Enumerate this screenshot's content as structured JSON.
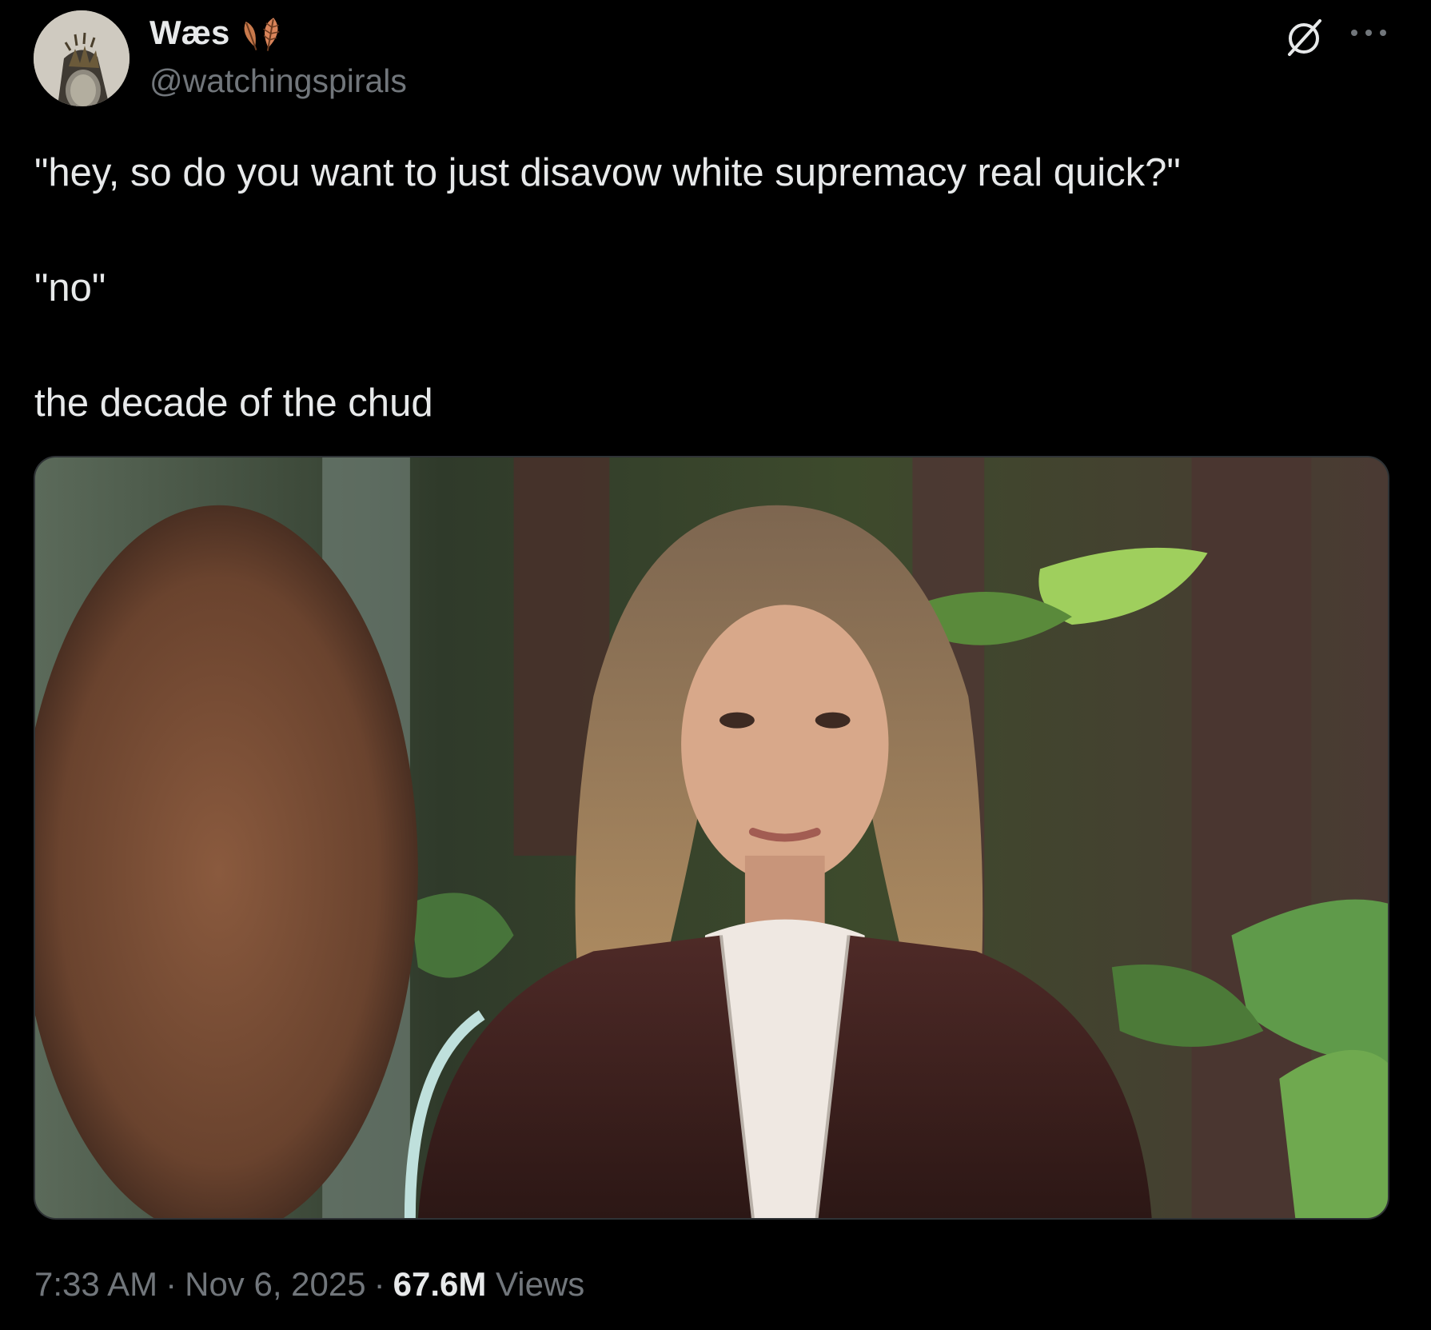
{
  "author": {
    "display_name": "Wæs",
    "handle": "@watchingspirals",
    "name_emoji": "leaf-icons",
    "avatar_icon": "avatar-icon"
  },
  "header_icons": {
    "grok": "grok-icon",
    "more": "more-options-icon"
  },
  "tweet": {
    "lines": [
      "\"hey, so do you want to just disavow white supremacy real quick?\"",
      "\"no\"",
      "the decade of the chud"
    ]
  },
  "media": {
    "type": "video-still-image"
  },
  "footer": {
    "time": "7:33 AM",
    "separator": "·",
    "date": "Nov 6, 2025",
    "views_count": "67.6M",
    "views_label": "Views"
  },
  "colors": {
    "background": "#000000",
    "primary_text": "#e7e9ea",
    "secondary_text": "#71767b",
    "border": "#2f3336"
  }
}
